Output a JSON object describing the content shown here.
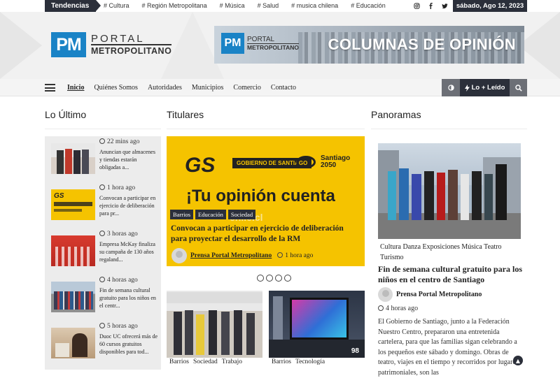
{
  "topbar": {
    "trending_label": "Tendencias",
    "tags": [
      "# Cultura",
      "# Región Metropolitana",
      "# Música",
      "# Salud",
      "# musica chilena",
      "# Educación"
    ],
    "socials": [
      "instagram-icon",
      "facebook-icon",
      "twitter-icon"
    ],
    "date": "sábado, Ago 12, 2023"
  },
  "header": {
    "logo_mark": "PM",
    "logo_line1": "PORTAL",
    "logo_line2": "METROPOLITANO",
    "banner_text": "COLUMNAS DE OPINIÓN",
    "banner_logo_mark": "PM",
    "banner_logo_line1": "PORTAL",
    "banner_logo_line2": "METROPOLITANO"
  },
  "nav": {
    "items": [
      "Inicio",
      "Quiénes Somos",
      "Autoridades",
      "Municipios",
      "Comercio",
      "Contacto"
    ],
    "active": "Inicio",
    "lo_mas_leido": "Lo + Leído"
  },
  "sections": {
    "latest": "Lo Último",
    "headlines": "Titulares",
    "panoramas": "Panoramas"
  },
  "latest": [
    {
      "time": "22 mins ago",
      "text": "Anuncian que almacenes y tiendas estarán obligadas a..."
    },
    {
      "time": "1 hora ago",
      "text": "Convocan a participar en ejercicio de deliberación para pr..."
    },
    {
      "time": "3 horas ago",
      "text": "Empresa McKay finaliza su campaña de 130 años regaland..."
    },
    {
      "time": "4 horas ago",
      "text": "Fin de semana cultural gratuito para los niños en el centr..."
    },
    {
      "time": "5 horas ago",
      "text": "Duoc UC ofrecerá más de 60 cursos gratuitos disponibles para tod..."
    }
  ],
  "featured": {
    "image_gs": "GS",
    "image_gob": "GOBIERNO DE SANTIAGO",
    "image_stgo_1": "Santiago",
    "image_stgo_2": "2050",
    "image_headline": "¡Tu opinión cuenta",
    "image_ghost": "chile.cl",
    "tags": [
      "Barrios",
      "Educación",
      "Sociedad"
    ],
    "title": "Convocan a participar en ejercicio de deliberación para proyectar el desarrollo de la RM",
    "author": "Prensa Portal Metropolitano",
    "time": "1 hora ago",
    "slides": 4
  },
  "cards": [
    {
      "tags": [
        "Barrios",
        "Sociedad",
        "Trabajo"
      ]
    },
    {
      "tags": [
        "Barrios",
        "Tecnología"
      ]
    }
  ],
  "panorama": {
    "tags": [
      "Cultura",
      "Danza",
      "Exposiciones",
      "Música",
      "Teatro",
      "Turismo"
    ],
    "title": "Fin de semana cultural gratuito para los niños en el centro de Santiago",
    "author": "Prensa Portal Metropolitano",
    "time": "4 horas ago",
    "body": "El Gobierno de Santiago, junto a la Federación Nuestro Centro, prepararon una entretenida cartelera, para que las familias sigan celebrando a los pequeños este sábado y domingo.  Obras de teatro, viajes en el tiempo y recorridos por lugares patrimoniales, son las"
  },
  "colors": {
    "dark": "#2b2f3a",
    "brand_blue": "#1a83c6",
    "yellow": "#f5c300"
  }
}
